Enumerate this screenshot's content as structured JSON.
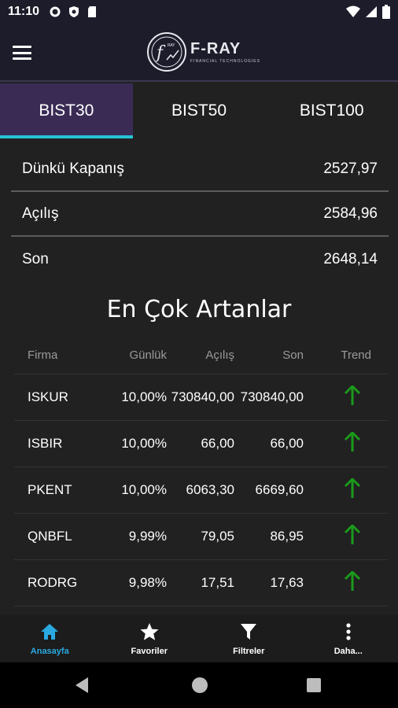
{
  "status_bar": {
    "time": "11:10",
    "left_icons": [
      "gear-icon",
      "shield-icon",
      "sd-card-icon"
    ],
    "right_icons": [
      "wifi-icon",
      "signal-icon",
      "battery-icon"
    ]
  },
  "app_bar": {
    "logo_title": "F-RAY",
    "logo_subtitle": "FINANCIAL TECHNOLOGIES",
    "logo_mark_text": "f",
    "logo_mark_small": "RAY"
  },
  "tabs": [
    {
      "label": "BIST30",
      "active": true
    },
    {
      "label": "BIST50",
      "active": false
    },
    {
      "label": "BIST100",
      "active": false
    }
  ],
  "summary": [
    {
      "label": "Dünkü Kapanış",
      "value": "2527,97"
    },
    {
      "label": "Açılış",
      "value": "2584,96"
    },
    {
      "label": "Son",
      "value": "2648,14"
    }
  ],
  "section_title": "En Çok Artanlar",
  "table": {
    "headers": [
      "Firma",
      "Günlük",
      "Açılış",
      "Son",
      "Trend"
    ],
    "rows": [
      {
        "firma": "ISKUR",
        "gunluk": "10,00%",
        "acilis": "730840,00",
        "son": "730840,00",
        "trend": "up"
      },
      {
        "firma": "ISBIR",
        "gunluk": "10,00%",
        "acilis": "66,00",
        "son": "66,00",
        "trend": "up"
      },
      {
        "firma": "PKENT",
        "gunluk": "10,00%",
        "acilis": "6063,30",
        "son": "6669,60",
        "trend": "up"
      },
      {
        "firma": "QNBFL",
        "gunluk": "9,99%",
        "acilis": "79,05",
        "son": "86,95",
        "trend": "up"
      },
      {
        "firma": "RODRG",
        "gunluk": "9,98%",
        "acilis": "17,51",
        "son": "17,63",
        "trend": "up"
      }
    ]
  },
  "bottom_nav": [
    {
      "label": "Anasayfa",
      "icon": "home-icon",
      "active": true
    },
    {
      "label": "Favoriler",
      "icon": "star-icon",
      "active": false
    },
    {
      "label": "Filtreler",
      "icon": "filter-icon",
      "active": false
    },
    {
      "label": "Daha...",
      "icon": "more-vertical-icon",
      "active": false
    }
  ],
  "colors": {
    "header_bg": "#1d1c2b",
    "active_tab_bg": "#3a2b55",
    "tab_indicator": "#27c3d6",
    "trend_up": "#1a9a1a",
    "nav_active": "#2aa9e0"
  }
}
